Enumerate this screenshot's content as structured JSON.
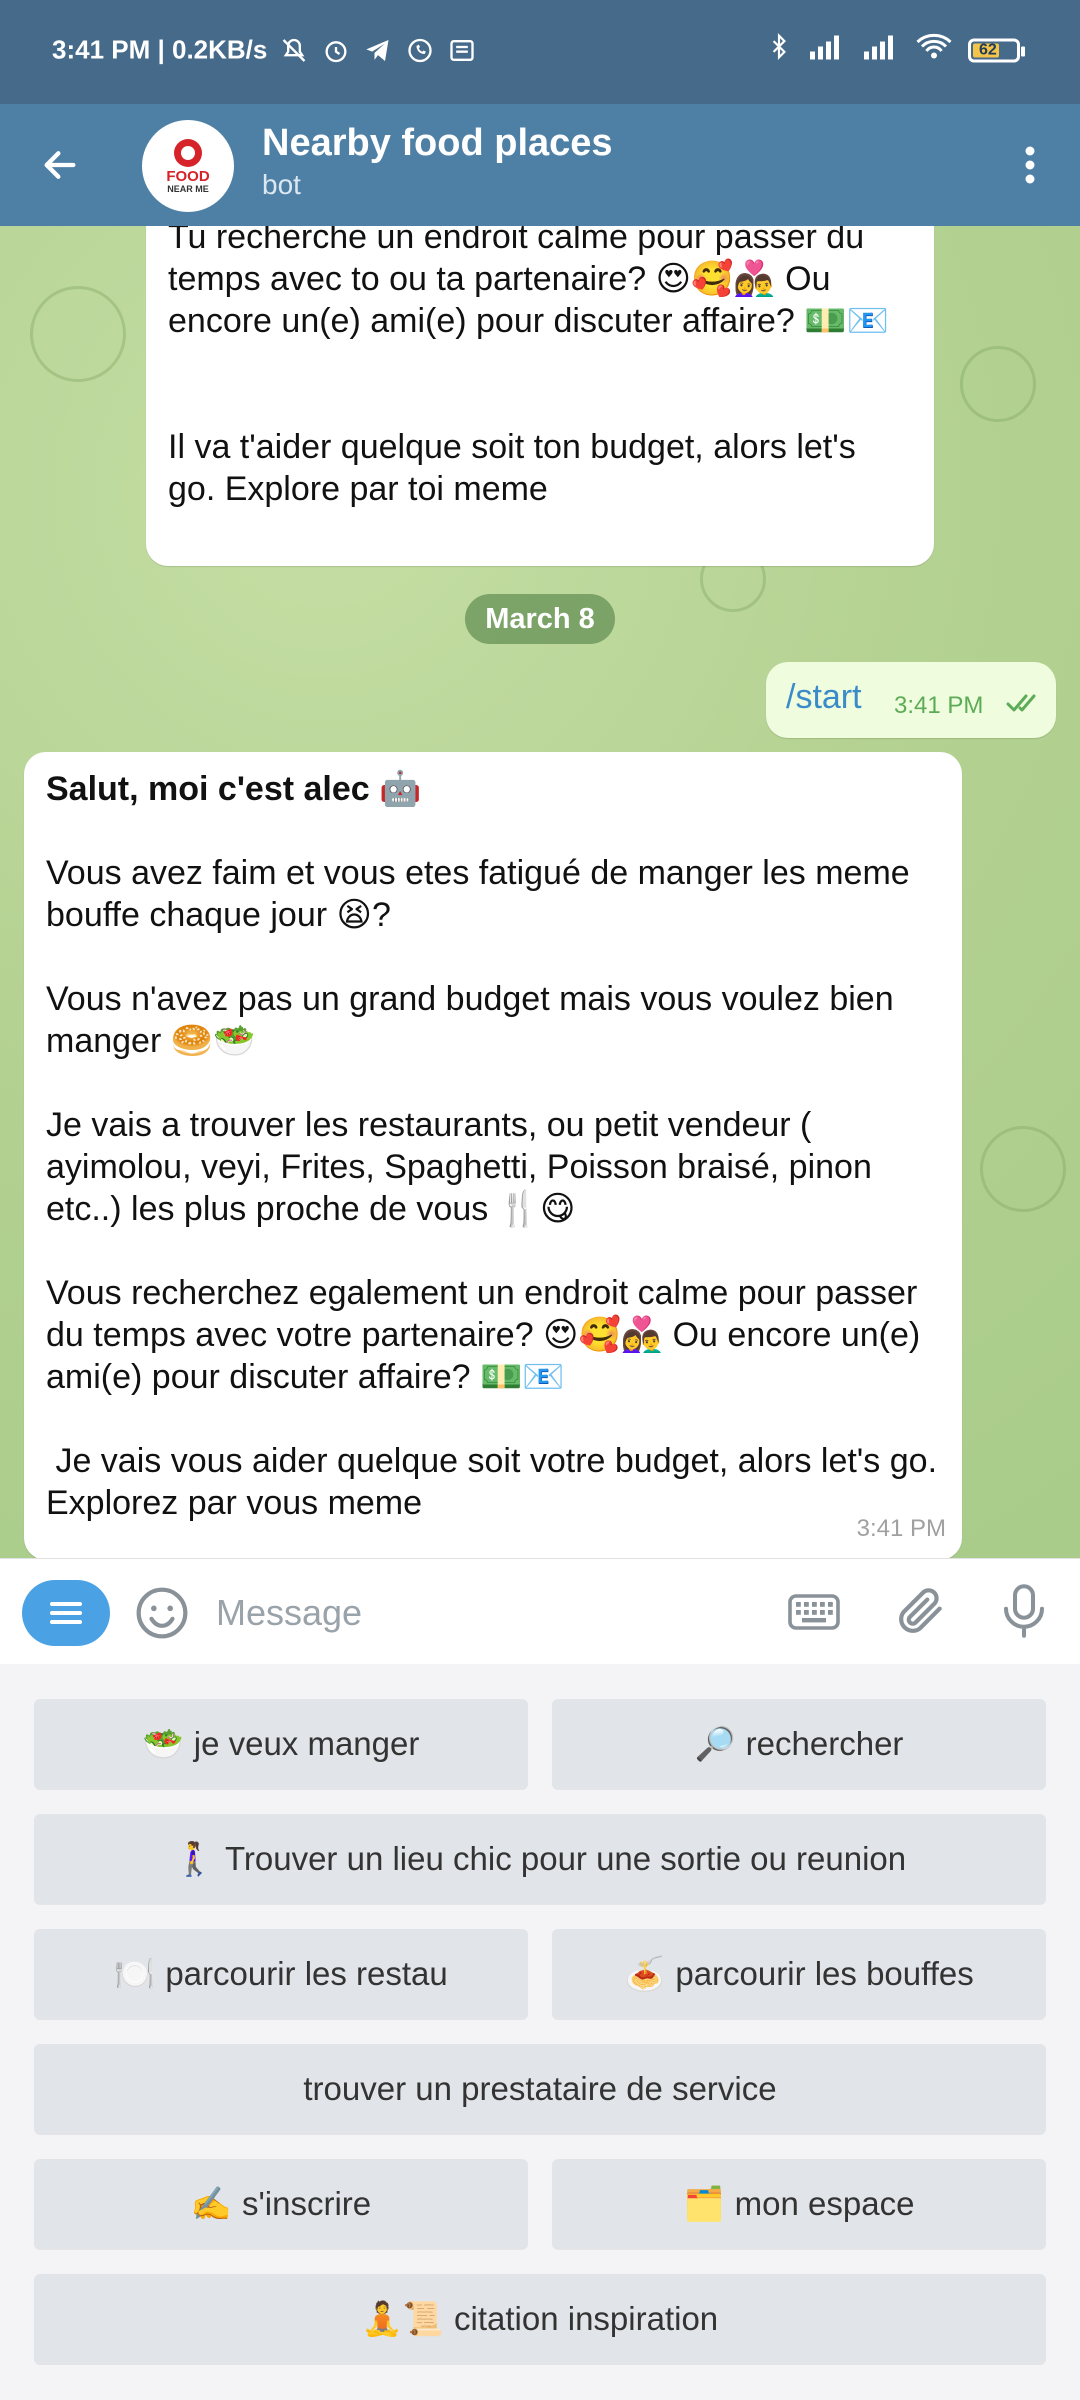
{
  "status_bar": {
    "time_network": "3:41 PM | 0.2KB/s",
    "battery": "62",
    "battery_level": 0.62
  },
  "header": {
    "title": "Nearby food places",
    "subtitle": "bot",
    "avatar_text_1": "FOOD",
    "avatar_text_2": "NEAR ME"
  },
  "messages": {
    "prev_bubble_text": "Tu recherche un endroit calme pour passer du temps avec to ou ta partenaire? 😍🥰👩‍❤️‍👨 Ou encore un(e) ami(e) pour discuter affaire? 💵📧\n\n\nIl va t'aider quelque soit ton budget, alors let's go. Explore par toi meme",
    "date_separator": "March 8",
    "outgoing": {
      "text": "/start",
      "time": "3:41 PM"
    },
    "bot_message": {
      "greeting": "Salut, moi c'est alec 🤖",
      "body": "Vous avez faim et vous etes fatigué de manger les meme bouffe chaque jour 😫?\n\nVous n'avez pas un grand budget mais vous voulez bien manger 🥯🥗\n\nJe vais a trouver les restaurants, ou petit vendeur ( ayimolou, veyi, Frites, Spaghetti, Poisson braisé, pinon etc..) les plus proche de vous 🍴😋\n\nVous recherchez egalement un endroit calme pour passer du temps avec votre partenaire? 😍🥰👩‍❤️‍👨 Ou encore un(e) ami(e) pour discuter affaire? 💵📧\n\n Je vais vous aider quelque soit votre budget, alors let's go. Explorez par vous meme",
      "time": "3:41 PM"
    }
  },
  "composer": {
    "placeholder": "Message"
  },
  "keyboard": {
    "buttons": [
      {
        "emoji": "🥗",
        "label": "je veux manger"
      },
      {
        "emoji": "🔎",
        "label": "rechercher"
      },
      {
        "emoji": "🚶‍♀️",
        "label": "Trouver un lieu chic pour une sortie ou reunion"
      },
      {
        "emoji": "🍽️",
        "label": "parcourir les restau"
      },
      {
        "emoji": "🍝",
        "label": "parcourir les bouffes"
      },
      {
        "emoji": "",
        "label": "trouver un prestataire de service"
      },
      {
        "emoji": "✍️",
        "label": "s'inscrire"
      },
      {
        "emoji": "🗂️",
        "label": "mon espace"
      },
      {
        "emoji": "🧘📜",
        "label": "citation inspiration"
      }
    ]
  },
  "colors": {
    "header_bg": "#4e7fa5",
    "status_bg": "#466a8a",
    "chat_bg": "#b3d191",
    "outgoing_bubble": "#effdde",
    "link_blue": "#3a8bc9",
    "check_green": "#5dab56",
    "menu_pill": "#4aa2e4"
  }
}
